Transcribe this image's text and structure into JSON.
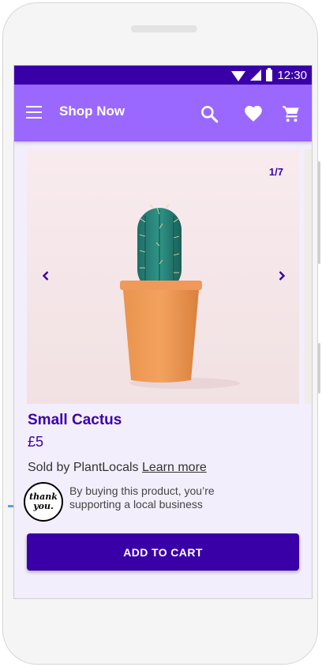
{
  "status_bar": {
    "time": "12:30"
  },
  "app_bar": {
    "title": "Shop Now",
    "icons": [
      "menu-icon",
      "search-icon",
      "heart-icon",
      "cart-icon"
    ]
  },
  "carousel": {
    "counter": "1/7"
  },
  "product": {
    "name": "Small Cactus",
    "price": "£5",
    "seller_prefix": "Sold by PlantLocals",
    "learn_more": "Learn more",
    "badge_line1": "thank",
    "badge_line2": "you.",
    "support_text": "By buying this product, you’re supporting a local business"
  },
  "cta": {
    "label": "ADD TO CART"
  },
  "colors": {
    "primary": "#3a00a8",
    "app_bar": "#9a68ff",
    "background": "#f3eefc",
    "status_bar": "#3a00a8"
  }
}
